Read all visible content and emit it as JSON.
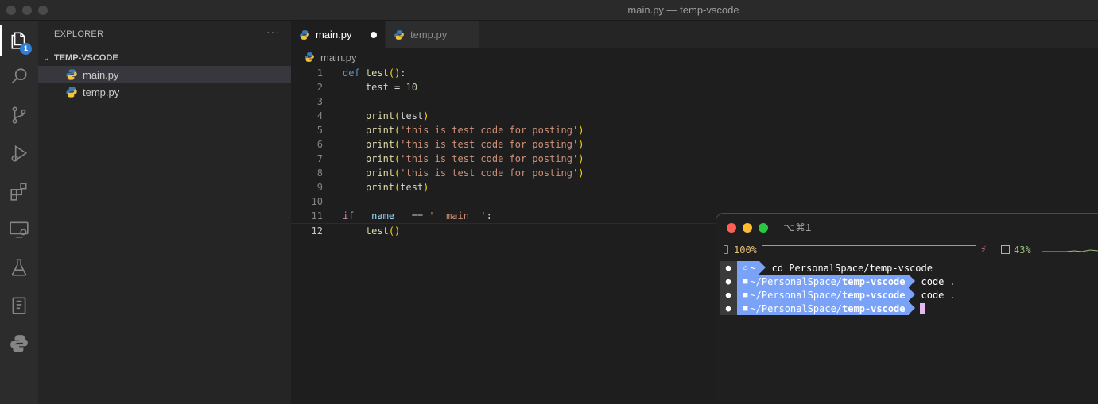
{
  "window": {
    "title": "main.py — temp-vscode"
  },
  "activity_bar": {
    "explorer_badge": "1",
    "items": [
      "explorer",
      "search",
      "source-control",
      "run-and-debug",
      "extensions",
      "remote-explorer",
      "testing",
      "notebook",
      "python"
    ]
  },
  "sidebar": {
    "header": "EXPLORER",
    "more": "···",
    "folder": "TEMP-VSCODE",
    "files": [
      {
        "name": "main.py",
        "selected": true
      },
      {
        "name": "temp.py",
        "selected": false
      }
    ]
  },
  "tabs": [
    {
      "label": "main.py",
      "active": true,
      "dirty": true
    },
    {
      "label": "temp.py",
      "active": false,
      "dirty": false
    }
  ],
  "breadcrumb": "main.py",
  "code": {
    "current_line": 12,
    "line_numbers": [
      "1",
      "2",
      "3",
      "4",
      "5",
      "6",
      "7",
      "8",
      "9",
      "10",
      "11",
      "12"
    ],
    "lines": [
      "def test():",
      "    test = 10",
      "",
      "    print(test)",
      "    print('this is test code for posting')",
      "    print('this is test code for posting')",
      "    print('this is test code for posting')",
      "    print('this is test code for posting')",
      "    print(test)",
      "",
      "if __name__ == '__main__':",
      "    test()"
    ]
  },
  "terminal": {
    "title": "⌥⌘1",
    "battery": "100%",
    "cpu": "43%",
    "prompts": [
      {
        "segment": "~",
        "segment_bold": "",
        "command": "cd PersonalSpace/temp-vscode"
      },
      {
        "segment": "~/PersonalSpace/",
        "segment_bold": "temp-vscode",
        "command": "code ."
      },
      {
        "segment": "~/PersonalSpace/",
        "segment_bold": "temp-vscode",
        "command": "code ."
      },
      {
        "segment": "~/PersonalSpace/",
        "segment_bold": "temp-vscode",
        "command": ""
      }
    ]
  },
  "colors": {
    "accent": "#2f7fd6",
    "prompt_segment": "#7aa2f7",
    "keyword": "#569cd6",
    "string": "#ce9178",
    "function": "#dcdcaa"
  }
}
